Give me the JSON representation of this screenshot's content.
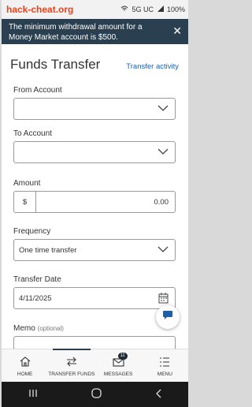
{
  "status": {
    "watermark": "hack-cheat.org",
    "network": "5G UC",
    "battery": "100%"
  },
  "banner": {
    "message": "The minimum withdrawal amount for a Money Market account is $500."
  },
  "header": {
    "title": "Funds Transfer",
    "activity_link": "Transfer activity"
  },
  "form": {
    "from_label": "From Account",
    "from_value": "",
    "to_label": "To Account",
    "to_value": "",
    "amount_label": "Amount",
    "currency": "$",
    "amount_value": "0.00",
    "frequency_label": "Frequency",
    "frequency_value": "One time transfer",
    "date_label": "Transfer Date",
    "date_value": "4/11/2025",
    "memo_label": "Memo",
    "memo_optional": "(optional)"
  },
  "tabs": [
    {
      "label": "HOME",
      "icon": "home-icon"
    },
    {
      "label": "TRANSFER FUNDS",
      "icon": "transfer-icon"
    },
    {
      "label": "MESSAGES",
      "icon": "mail-icon",
      "badge": "11"
    },
    {
      "label": "MENU",
      "icon": "menu-icon"
    }
  ],
  "colors": {
    "banner_bg": "#2a4050",
    "link": "#1f5fa8",
    "watermark": "#e8441e"
  }
}
